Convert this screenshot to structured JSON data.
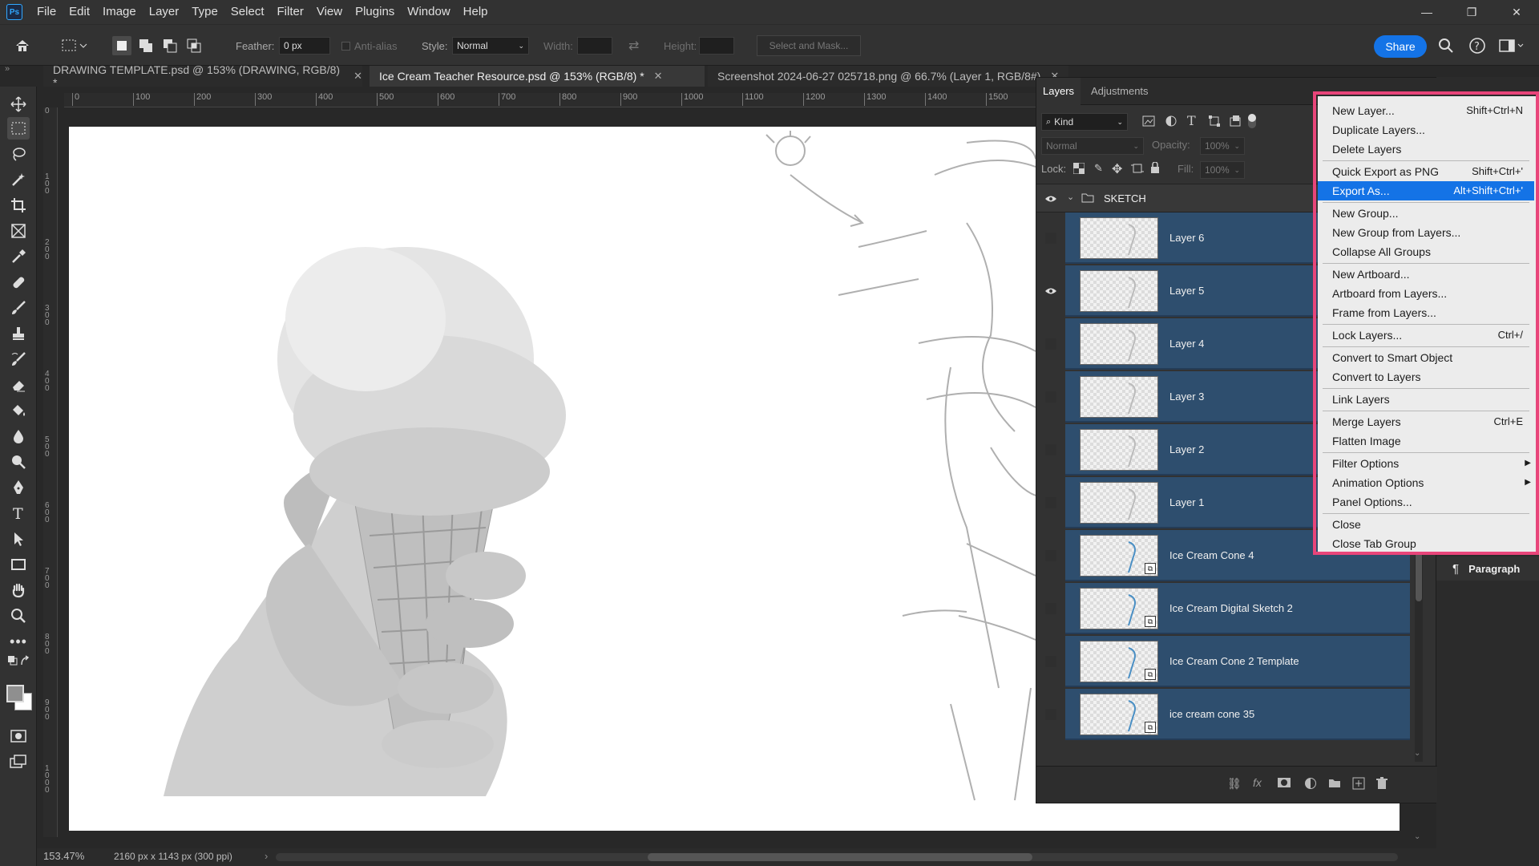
{
  "app": {
    "logo": "Ps"
  },
  "menubar": [
    "File",
    "Edit",
    "Image",
    "Layer",
    "Type",
    "Select",
    "Filter",
    "View",
    "Plugins",
    "Window",
    "Help"
  ],
  "window_controls": {
    "minimize": "—",
    "restore": "❐",
    "close": "✕"
  },
  "options": {
    "feather_label": "Feather:",
    "feather_value": "0 px",
    "anti_alias_label": "Anti-alias",
    "style_label": "Style:",
    "style_value": "Normal",
    "width_label": "Width:",
    "height_label": "Height:",
    "select_mask_label": "Select and Mask...",
    "share_label": "Share"
  },
  "tabs": [
    {
      "label": "DRAWING TEMPLATE.psd @ 153% (DRAWING, RGB/8) *",
      "active": false
    },
    {
      "label": "Ice Cream Teacher Resource.psd @ 153% (RGB/8) *",
      "active": true
    },
    {
      "label": "Screenshot 2024-06-27 025718.png @ 66.7% (Layer 1, RGB/8#)",
      "active": false
    }
  ],
  "ruler_top": [
    "0",
    "100",
    "200",
    "300",
    "400",
    "500",
    "600",
    "700",
    "800",
    "900",
    "1000",
    "1100",
    "1200",
    "1300",
    "1400",
    "1500"
  ],
  "ruler_left": [
    "0",
    "100",
    "200",
    "300",
    "400",
    "500",
    "600",
    "700",
    "800",
    "900",
    "1000"
  ],
  "status": {
    "zoom": "153.47%",
    "doc_info": "2160 px x 1143 px (300 ppi)"
  },
  "layers_panel": {
    "tabs": [
      "Layers",
      "Adjustments"
    ],
    "kind_label": "Kind",
    "blend_mode": "Normal",
    "opacity_label": "Opacity:",
    "opacity_value": "100%",
    "lock_label": "Lock:",
    "fill_label": "Fill:",
    "fill_value": "100%",
    "group_name": "SKETCH",
    "layers": [
      {
        "name": "Layer 6",
        "visible": false,
        "smart": false
      },
      {
        "name": "Layer 5",
        "visible": true,
        "smart": false
      },
      {
        "name": "Layer 4",
        "visible": false,
        "smart": false
      },
      {
        "name": "Layer 3",
        "visible": false,
        "smart": false
      },
      {
        "name": "Layer 2",
        "visible": false,
        "smart": false
      },
      {
        "name": "Layer 1",
        "visible": false,
        "smart": false
      },
      {
        "name": "Ice Cream Cone 4",
        "visible": false,
        "smart": true
      },
      {
        "name": "Ice Cream Digital Sketch 2",
        "visible": false,
        "smart": true
      },
      {
        "name": "Ice Cream Cone 2 Template",
        "visible": false,
        "smart": true
      },
      {
        "name": "ice cream cone 35",
        "visible": false,
        "smart": true
      }
    ]
  },
  "paragraph_panel": {
    "label": "Paragraph"
  },
  "flyout_menu": {
    "items": [
      {
        "label": "New Layer...",
        "shortcut": "Shift+Ctrl+N"
      },
      {
        "label": "Duplicate Layers..."
      },
      {
        "label": "Delete Layers"
      },
      {
        "separator": true
      },
      {
        "label": "Quick Export as PNG",
        "shortcut": "Shift+Ctrl+'"
      },
      {
        "label": "Export As...",
        "shortcut": "Alt+Shift+Ctrl+'",
        "highlighted": true
      },
      {
        "separator": true
      },
      {
        "label": "New Group..."
      },
      {
        "label": "New Group from Layers..."
      },
      {
        "label": "Collapse All Groups"
      },
      {
        "separator": true
      },
      {
        "label": "New Artboard..."
      },
      {
        "label": "Artboard from Layers..."
      },
      {
        "label": "Frame from Layers..."
      },
      {
        "separator": true
      },
      {
        "label": "Lock Layers...",
        "shortcut": "Ctrl+/"
      },
      {
        "separator": true
      },
      {
        "label": "Convert to Smart Object"
      },
      {
        "label": "Convert to Layers"
      },
      {
        "separator": true
      },
      {
        "label": "Link Layers"
      },
      {
        "separator": true
      },
      {
        "label": "Merge Layers",
        "shortcut": "Ctrl+E"
      },
      {
        "label": "Flatten Image"
      },
      {
        "separator": true
      },
      {
        "label": "Filter Options",
        "submenu": true
      },
      {
        "label": "Animation Options",
        "submenu": true
      },
      {
        "label": "Panel Options..."
      },
      {
        "separator": true
      },
      {
        "label": "Close"
      },
      {
        "label": "Close Tab Group"
      }
    ]
  },
  "colors": {
    "accent": "#1473e6",
    "highlight_border": "#e8457a",
    "selected_layer": "#2e4e6e"
  }
}
